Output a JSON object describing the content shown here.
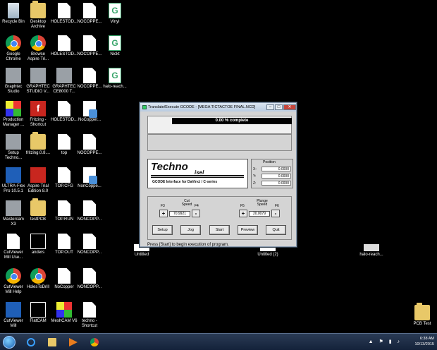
{
  "desktop_icons": [
    {
      "label": "Recycle Bin",
      "icon": "recycle-bin-icon",
      "kind": "recycle",
      "col": 0,
      "row": 0
    },
    {
      "label": "Google Chrome",
      "icon": "chrome-icon",
      "kind": "chrome",
      "col": 0,
      "row": 1
    },
    {
      "label": "Graphtec Studio",
      "icon": "graphtec-icon",
      "kind": "gray",
      "col": 0,
      "row": 2
    },
    {
      "label": "Production Manager ...",
      "icon": "production-manager-icon",
      "kind": "multi",
      "col": 0,
      "row": 3
    },
    {
      "label": "Setup Techno...",
      "icon": "setup-icon",
      "kind": "gray",
      "col": 0,
      "row": 4
    },
    {
      "label": "ULTRA-Flex Pro 10.5.1",
      "icon": "ultraflex-icon",
      "kind": "blue",
      "col": 0,
      "row": 5
    },
    {
      "label": "Mastercam X3",
      "icon": "mastercam-icon",
      "kind": "gray",
      "col": 0,
      "row": 6
    },
    {
      "label": "CutViewer Mill Use...",
      "icon": "document-icon",
      "kind": "doc",
      "col": 0,
      "row": 7
    },
    {
      "label": "CutViewer Mill Help",
      "icon": "chrome-icon",
      "kind": "chrome",
      "col": 0,
      "row": 8
    },
    {
      "label": "CutViewer Mill",
      "icon": "cutviewer-icon",
      "kind": "blue",
      "col": 0,
      "row": 9
    },
    {
      "label": "Desktop Archive",
      "icon": "folder-icon",
      "kind": "folder",
      "col": 1,
      "row": 0
    },
    {
      "label": "Browse Aspire Tri...",
      "icon": "chrome-icon",
      "kind": "chrome",
      "col": 1,
      "row": 1
    },
    {
      "label": "GRAPHTEC STUDIO V...",
      "icon": "graphtec-icon",
      "kind": "gray",
      "col": 1,
      "row": 2
    },
    {
      "label": "Fritzing - Shortcut",
      "icon": "fritzing-icon",
      "kind": "red",
      "col": 1,
      "row": 3
    },
    {
      "label": "fritzing.0.8....",
      "icon": "folder-icon",
      "kind": "folder",
      "col": 1,
      "row": 4
    },
    {
      "label": "Aspire Trial Edition 8.0",
      "icon": "aspire-icon",
      "kind": "red",
      "col": 1,
      "row": 5
    },
    {
      "label": "testPCB",
      "icon": "folder-icon",
      "kind": "folder",
      "col": 1,
      "row": 6
    },
    {
      "label": "anders",
      "icon": "anders-icon",
      "kind": "flat",
      "col": 1,
      "row": 7
    },
    {
      "label": "HolesToDrill",
      "icon": "chrome-icon",
      "kind": "chrome",
      "col": 1,
      "row": 8
    },
    {
      "label": "FlatCAM",
      "icon": "flatcam-icon",
      "kind": "flat",
      "col": 1,
      "row": 9
    },
    {
      "label": "HOLESTOD...",
      "icon": "document-icon",
      "kind": "doc",
      "col": 2,
      "row": 0
    },
    {
      "label": "HOLESTOD...",
      "icon": "document-icon",
      "kind": "doc",
      "col": 2,
      "row": 1
    },
    {
      "label": "GRAPHTEC CE8000 T...",
      "icon": "graphtec-icon",
      "kind": "gray",
      "col": 2,
      "row": 2
    },
    {
      "label": "HOLESTOD...",
      "icon": "document-icon",
      "kind": "doc",
      "col": 2,
      "row": 3
    },
    {
      "label": "top",
      "icon": "document-icon",
      "kind": "doc",
      "col": 2,
      "row": 4
    },
    {
      "label": "TOP.CFG",
      "icon": "document-icon",
      "kind": "doc",
      "col": 2,
      "row": 5
    },
    {
      "label": "TOP.RUN",
      "icon": "document-icon",
      "kind": "doc",
      "col": 2,
      "row": 6
    },
    {
      "label": "TOP.OUT",
      "icon": "document-icon",
      "kind": "doc",
      "col": 2,
      "row": 7
    },
    {
      "label": "NoCopper",
      "icon": "document-icon",
      "kind": "doc",
      "col": 2,
      "row": 8
    },
    {
      "label": "MeshCAM V6",
      "icon": "meshcam-icon",
      "kind": "multi",
      "col": 2,
      "row": 9
    },
    {
      "label": "NOCOPPE...",
      "icon": "document-icon",
      "kind": "doc",
      "col": 3,
      "row": 0
    },
    {
      "label": "NOCOPPE...",
      "icon": "document-icon",
      "kind": "doc",
      "col": 3,
      "row": 1
    },
    {
      "label": "NOCOPPE...",
      "icon": "document-icon",
      "kind": "doc",
      "col": 3,
      "row": 2
    },
    {
      "label": "NoCopper...",
      "icon": "nocopper-icon",
      "kind": "copper",
      "col": 3,
      "row": 3
    },
    {
      "label": "NOCOPPE...",
      "icon": "document-icon",
      "kind": "doc",
      "col": 3,
      "row": 4
    },
    {
      "label": "NonCoppe...",
      "icon": "nocopper-icon",
      "kind": "copper",
      "col": 3,
      "row": 5
    },
    {
      "label": "NONCOPP...",
      "icon": "document-icon",
      "kind": "doc",
      "col": 3,
      "row": 6
    },
    {
      "label": "NONCOPP...",
      "icon": "document-icon",
      "kind": "doc",
      "col": 3,
      "row": 7
    },
    {
      "label": "NONCOPP...",
      "icon": "document-icon",
      "kind": "doc",
      "col": 3,
      "row": 8
    },
    {
      "label": "techno - Shortcut",
      "icon": "techno-icon",
      "kind": "doc",
      "col": 3,
      "row": 9
    },
    {
      "label": "Vinyl",
      "icon": "graphtec-g-icon",
      "kind": "glyph",
      "col": 4,
      "row": 0
    },
    {
      "label": "Nickt",
      "icon": "graphtec-g-icon",
      "kind": "glyph",
      "col": 4,
      "row": 1
    },
    {
      "label": "halo-reach...",
      "icon": "graphtec-g-icon",
      "kind": "glyph",
      "col": 4,
      "row": 2
    }
  ],
  "window": {
    "title": "Translate/Execute GCODE - [MEGA TICTACTOE FINAL.NCD]",
    "progress_text": "0.00 % complete",
    "logo_big": "Techno",
    "logo_small": "isel",
    "logo_sub": "GCODE Interface for DaVinci / C-series",
    "position_title": "Position",
    "x_label": "X:",
    "x_value": "0.0000",
    "y_label": "Y:",
    "y_value": "0.0000",
    "z_label": "Z:",
    "z_value": "0.0000",
    "f3": "F3",
    "f4": "F4",
    "f5": "F5",
    "f6": "F6",
    "cut_label_1": "Cut",
    "cut_label_2": "Speed",
    "cut_value": "70.9921",
    "plunge_label_1": "Plunge",
    "plunge_label_2": "Speed",
    "plunge_value": "20.0079",
    "plus": "+",
    "minus": "-",
    "buttons": {
      "setup": "Setup",
      "jog": "Jog",
      "start": "Start",
      "preview": "Preview",
      "quit": "Quit"
    },
    "status": "Press [Start] to begin execution of program."
  },
  "minimized": [
    {
      "label": "Untitled"
    },
    {
      "label": "Untitled (2)"
    },
    {
      "label": "halo-reach..."
    }
  ],
  "bottom_right_icon": {
    "label": "PCB Test"
  },
  "taskbar": {
    "time": "6:38 AM",
    "date": "10/13/2015"
  }
}
